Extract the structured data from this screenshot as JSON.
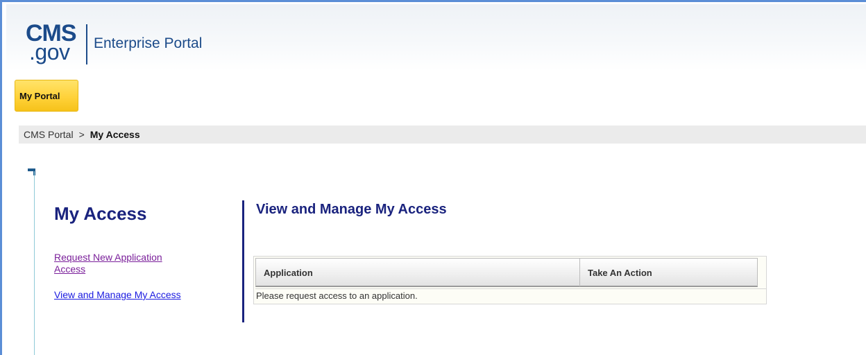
{
  "header": {
    "logo": {
      "cms": "CMS",
      "gov": ".gov"
    },
    "portal_name": "Enterprise Portal"
  },
  "nav": {
    "tab_label": "My Portal"
  },
  "breadcrumb": {
    "root": "CMS Portal",
    "separator": ">",
    "current": "My Access"
  },
  "sidebar": {
    "title": "My Access",
    "links": [
      {
        "label": "Request New Application Access"
      },
      {
        "label": "View and Manage My Access"
      }
    ]
  },
  "main": {
    "title": "View and Manage My Access",
    "table": {
      "columns": [
        "Application",
        "Take An Action"
      ],
      "empty_message": "Please request access to an application."
    }
  },
  "colors": {
    "brand": "#1c4b8a",
    "heading": "#1a237e",
    "tab": "#ffd23a",
    "visited_link": "#7a1f9a",
    "link": "#1a1ae0",
    "frame_border": "#5b8ed6"
  }
}
